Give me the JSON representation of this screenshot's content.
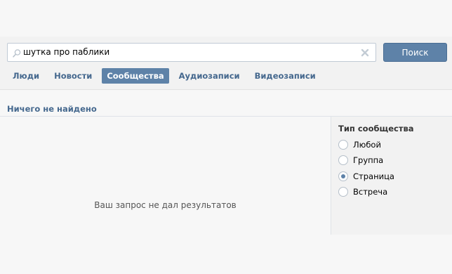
{
  "search": {
    "value": "шутка про паблики",
    "button_label": "Поиск"
  },
  "tabs": [
    {
      "label": "Люди",
      "active": false
    },
    {
      "label": "Новости",
      "active": false
    },
    {
      "label": "Сообщества",
      "active": true
    },
    {
      "label": "Аудиозаписи",
      "active": false
    },
    {
      "label": "Видеозаписи",
      "active": false
    }
  ],
  "results": {
    "title": "Ничего не найдено",
    "empty_message": "Ваш запрос не дал результатов"
  },
  "filter": {
    "title": "Тип сообщества",
    "options": [
      {
        "label": "Любой",
        "checked": false
      },
      {
        "label": "Группа",
        "checked": false
      },
      {
        "label": "Страница",
        "checked": true
      },
      {
        "label": "Встреча",
        "checked": false
      }
    ]
  },
  "colors": {
    "accent": "#5e82a8",
    "link": "#45688e",
    "background": "#f7f7f7",
    "panel": "#f2f2f2"
  },
  "icons": {
    "search": "search-icon",
    "clear": "close-icon"
  }
}
